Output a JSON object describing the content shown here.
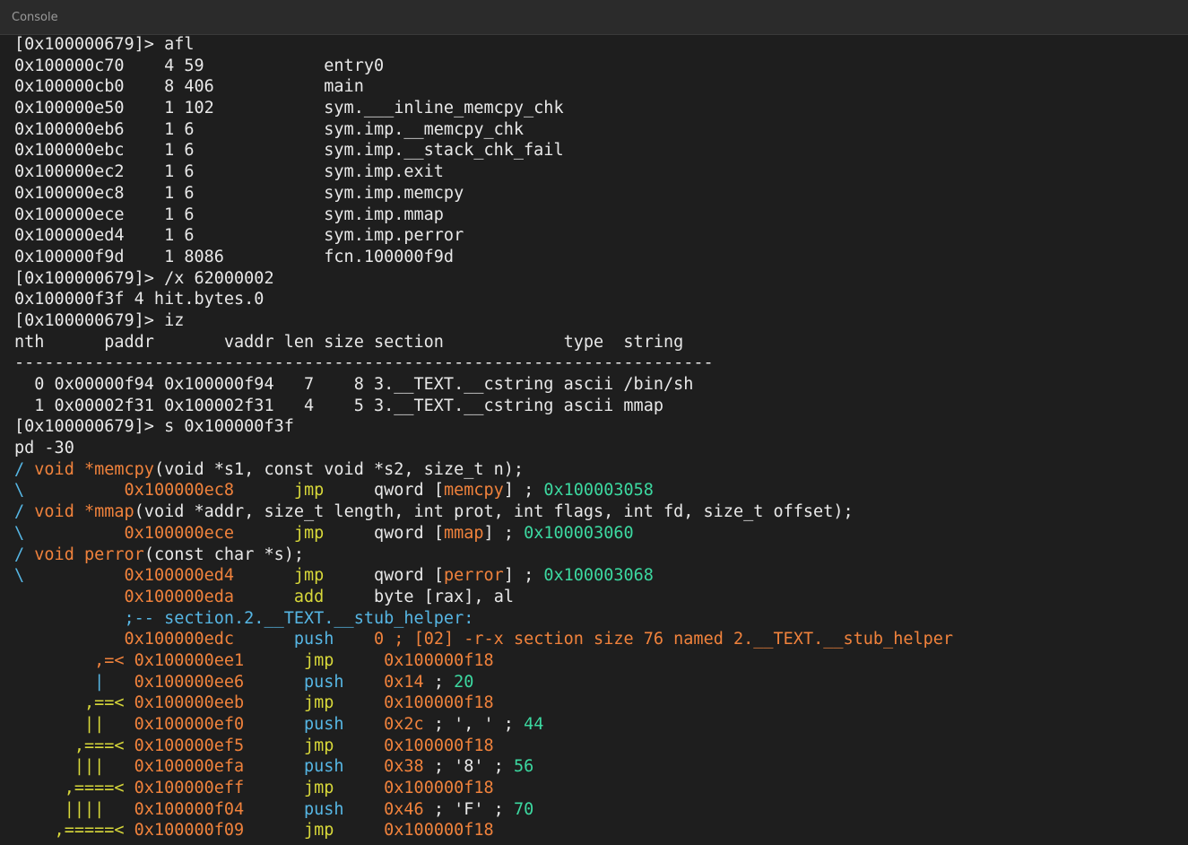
{
  "window": {
    "title": "Console"
  },
  "colors": {
    "background": "#1e1e1e",
    "text": "#e8e8e8",
    "address": "#f0823c",
    "mnemonic": "#d8d83a",
    "flow": "#56b6e4",
    "number": "#3cd8a0",
    "muted": "#8a8a8a"
  },
  "console": {
    "lines": [
      {
        "segments": [
          {
            "text": "[0x100000679]> afl",
            "color": "plain"
          }
        ]
      },
      {
        "segments": [
          {
            "text": "0x100000c70    4 59            entry0",
            "color": "plain"
          }
        ]
      },
      {
        "segments": [
          {
            "text": "0x100000cb0    8 406           main",
            "color": "plain"
          }
        ]
      },
      {
        "segments": [
          {
            "text": "0x100000e50    1 102           sym.___inline_memcpy_chk",
            "color": "plain"
          }
        ]
      },
      {
        "segments": [
          {
            "text": "0x100000eb6    1 6             sym.imp.__memcpy_chk",
            "color": "plain"
          }
        ]
      },
      {
        "segments": [
          {
            "text": "0x100000ebc    1 6             sym.imp.__stack_chk_fail",
            "color": "plain"
          }
        ]
      },
      {
        "segments": [
          {
            "text": "0x100000ec2    1 6             sym.imp.exit",
            "color": "plain"
          }
        ]
      },
      {
        "segments": [
          {
            "text": "0x100000ec8    1 6             sym.imp.memcpy",
            "color": "plain"
          }
        ]
      },
      {
        "segments": [
          {
            "text": "0x100000ece    1 6             sym.imp.mmap",
            "color": "plain"
          }
        ]
      },
      {
        "segments": [
          {
            "text": "0x100000ed4    1 6             sym.imp.perror",
            "color": "plain"
          }
        ]
      },
      {
        "segments": [
          {
            "text": "0x100000f9d    1 8086          fcn.100000f9d",
            "color": "plain"
          }
        ]
      },
      {
        "segments": [
          {
            "text": "[0x100000679]> /x 62000002",
            "color": "plain"
          }
        ]
      },
      {
        "segments": [
          {
            "text": "0x100000f3f 4 hit.bytes.0",
            "color": "plain"
          }
        ]
      },
      {
        "segments": [
          {
            "text": "[0x100000679]> iz",
            "color": "plain"
          }
        ]
      },
      {
        "segments": [
          {
            "text": "nth      paddr       vaddr len size section            type  string",
            "color": "plain"
          }
        ]
      },
      {
        "segments": [
          {
            "text": "----------------------------------------------------------------------",
            "color": "plain"
          }
        ]
      },
      {
        "segments": [
          {
            "text": "  0 0x00000f94 0x100000f94   7    8 3.__TEXT.__cstring ascii /bin/sh",
            "color": "plain"
          }
        ]
      },
      {
        "segments": [
          {
            "text": "  1 0x00002f31 0x100002f31   4    5 3.__TEXT.__cstring ascii mmap",
            "color": "plain"
          }
        ]
      },
      {
        "segments": [
          {
            "text": "[0x100000679]> s 0x100000f3f",
            "color": "plain"
          }
        ]
      },
      {
        "segments": [
          {
            "text": "pd -30",
            "color": "plain"
          }
        ]
      },
      {
        "segments": [
          {
            "text": "/ ",
            "color": "sky"
          },
          {
            "text": "void *memcpy",
            "color": "orange"
          },
          {
            "text": "(void *s1, const void *s2, size_t n);",
            "color": "plain"
          }
        ]
      },
      {
        "segments": [
          {
            "text": "\\          ",
            "color": "sky"
          },
          {
            "text": "0x100000ec8",
            "color": "orange"
          },
          {
            "text": "      ",
            "color": "plain"
          },
          {
            "text": "jmp",
            "color": "yellow"
          },
          {
            "text": "     qword ",
            "color": "muted"
          },
          {
            "text": "[",
            "color": "muted"
          },
          {
            "text": "memcpy",
            "color": "orange"
          },
          {
            "text": "]",
            "color": "muted"
          },
          {
            "text": " ; ",
            "color": "muted"
          },
          {
            "text": "0x100003058",
            "color": "green"
          }
        ]
      },
      {
        "segments": [
          {
            "text": "/ ",
            "color": "sky"
          },
          {
            "text": "void *mmap",
            "color": "orange"
          },
          {
            "text": "(void *addr, size_t length, int prot, int flags, int fd, size_t offset);",
            "color": "plain"
          }
        ]
      },
      {
        "segments": [
          {
            "text": "\\          ",
            "color": "sky"
          },
          {
            "text": "0x100000ece",
            "color": "orange"
          },
          {
            "text": "      ",
            "color": "plain"
          },
          {
            "text": "jmp",
            "color": "yellow"
          },
          {
            "text": "     qword ",
            "color": "muted"
          },
          {
            "text": "[",
            "color": "muted"
          },
          {
            "text": "mmap",
            "color": "orange"
          },
          {
            "text": "]",
            "color": "muted"
          },
          {
            "text": " ; ",
            "color": "muted"
          },
          {
            "text": "0x100003060",
            "color": "green"
          }
        ]
      },
      {
        "segments": [
          {
            "text": "/ ",
            "color": "sky"
          },
          {
            "text": "void perror",
            "color": "orange"
          },
          {
            "text": "(const char *s);",
            "color": "plain"
          }
        ]
      },
      {
        "segments": [
          {
            "text": "\\          ",
            "color": "sky"
          },
          {
            "text": "0x100000ed4",
            "color": "orange"
          },
          {
            "text": "      ",
            "color": "plain"
          },
          {
            "text": "jmp",
            "color": "yellow"
          },
          {
            "text": "     qword ",
            "color": "muted"
          },
          {
            "text": "[",
            "color": "muted"
          },
          {
            "text": "perror",
            "color": "orange"
          },
          {
            "text": "]",
            "color": "muted"
          },
          {
            "text": " ; ",
            "color": "muted"
          },
          {
            "text": "0x100003068",
            "color": "green"
          }
        ]
      },
      {
        "segments": [
          {
            "text": "           ",
            "color": "plain"
          },
          {
            "text": "0x100000eda",
            "color": "orange"
          },
          {
            "text": "      ",
            "color": "plain"
          },
          {
            "text": "add",
            "color": "yellow"
          },
          {
            "text": "     byte ",
            "color": "muted"
          },
          {
            "text": "[",
            "color": "muted"
          },
          {
            "text": "rax",
            "color": "plain"
          },
          {
            "text": "], ",
            "color": "muted"
          },
          {
            "text": "al",
            "color": "plain"
          }
        ]
      },
      {
        "segments": [
          {
            "text": "           ;-- section.2.__TEXT.__stub_helper:",
            "color": "sky"
          }
        ]
      },
      {
        "segments": [
          {
            "text": "           ",
            "color": "plain"
          },
          {
            "text": "0x100000edc",
            "color": "orange"
          },
          {
            "text": "      ",
            "color": "plain"
          },
          {
            "text": "push",
            "color": "sky"
          },
          {
            "text": "    ",
            "color": "plain"
          },
          {
            "text": "0 ; [02] -r-x section size 76 named 2.__TEXT.__stub_helper",
            "color": "orange"
          }
        ]
      },
      {
        "segments": [
          {
            "text": "        ,=< ",
            "color": "orange"
          },
          {
            "text": "0x100000ee1",
            "color": "orange"
          },
          {
            "text": "      ",
            "color": "plain"
          },
          {
            "text": "jmp",
            "color": "yellow"
          },
          {
            "text": "     ",
            "color": "plain"
          },
          {
            "text": "0x100000f18",
            "color": "orange"
          }
        ]
      },
      {
        "segments": [
          {
            "text": "        |   ",
            "color": "sky"
          },
          {
            "text": "0x100000ee6",
            "color": "orange"
          },
          {
            "text": "      ",
            "color": "plain"
          },
          {
            "text": "push",
            "color": "sky"
          },
          {
            "text": "    ",
            "color": "plain"
          },
          {
            "text": "0x14",
            "color": "orange"
          },
          {
            "text": " ; ",
            "color": "muted"
          },
          {
            "text": "20",
            "color": "green"
          }
        ]
      },
      {
        "segments": [
          {
            "text": "       ,==< ",
            "color": "yellow"
          },
          {
            "text": "0x100000eeb",
            "color": "orange"
          },
          {
            "text": "      ",
            "color": "plain"
          },
          {
            "text": "jmp",
            "color": "yellow"
          },
          {
            "text": "     ",
            "color": "plain"
          },
          {
            "text": "0x100000f18",
            "color": "orange"
          }
        ]
      },
      {
        "segments": [
          {
            "text": "       ||   ",
            "color": "yellow"
          },
          {
            "text": "0x100000ef0",
            "color": "orange"
          },
          {
            "text": "      ",
            "color": "plain"
          },
          {
            "text": "push",
            "color": "sky"
          },
          {
            "text": "    ",
            "color": "plain"
          },
          {
            "text": "0x2c",
            "color": "orange"
          },
          {
            "text": " ; ', ' ; ",
            "color": "muted"
          },
          {
            "text": "44",
            "color": "green"
          }
        ]
      },
      {
        "segments": [
          {
            "text": "      ,===< ",
            "color": "yellow"
          },
          {
            "text": "0x100000ef5",
            "color": "orange"
          },
          {
            "text": "      ",
            "color": "plain"
          },
          {
            "text": "jmp",
            "color": "yellow"
          },
          {
            "text": "     ",
            "color": "plain"
          },
          {
            "text": "0x100000f18",
            "color": "orange"
          }
        ]
      },
      {
        "segments": [
          {
            "text": "      |||   ",
            "color": "yellow"
          },
          {
            "text": "0x100000efa",
            "color": "orange"
          },
          {
            "text": "      ",
            "color": "plain"
          },
          {
            "text": "push",
            "color": "sky"
          },
          {
            "text": "    ",
            "color": "plain"
          },
          {
            "text": "0x38",
            "color": "orange"
          },
          {
            "text": " ; '8' ; ",
            "color": "muted"
          },
          {
            "text": "56",
            "color": "green"
          }
        ]
      },
      {
        "segments": [
          {
            "text": "     ,====< ",
            "color": "yellow"
          },
          {
            "text": "0x100000eff",
            "color": "orange"
          },
          {
            "text": "      ",
            "color": "plain"
          },
          {
            "text": "jmp",
            "color": "yellow"
          },
          {
            "text": "     ",
            "color": "plain"
          },
          {
            "text": "0x100000f18",
            "color": "orange"
          }
        ]
      },
      {
        "segments": [
          {
            "text": "     ||||   ",
            "color": "yellow"
          },
          {
            "text": "0x100000f04",
            "color": "orange"
          },
          {
            "text": "      ",
            "color": "plain"
          },
          {
            "text": "push",
            "color": "sky"
          },
          {
            "text": "    ",
            "color": "plain"
          },
          {
            "text": "0x46",
            "color": "orange"
          },
          {
            "text": " ; 'F' ; ",
            "color": "muted"
          },
          {
            "text": "70",
            "color": "green"
          }
        ]
      },
      {
        "segments": [
          {
            "text": "    ,=====< ",
            "color": "yellow"
          },
          {
            "text": "0x100000f09",
            "color": "orange"
          },
          {
            "text": "      ",
            "color": "plain"
          },
          {
            "text": "jmp",
            "color": "yellow"
          },
          {
            "text": "     ",
            "color": "plain"
          },
          {
            "text": "0x100000f18",
            "color": "orange"
          }
        ]
      }
    ]
  }
}
